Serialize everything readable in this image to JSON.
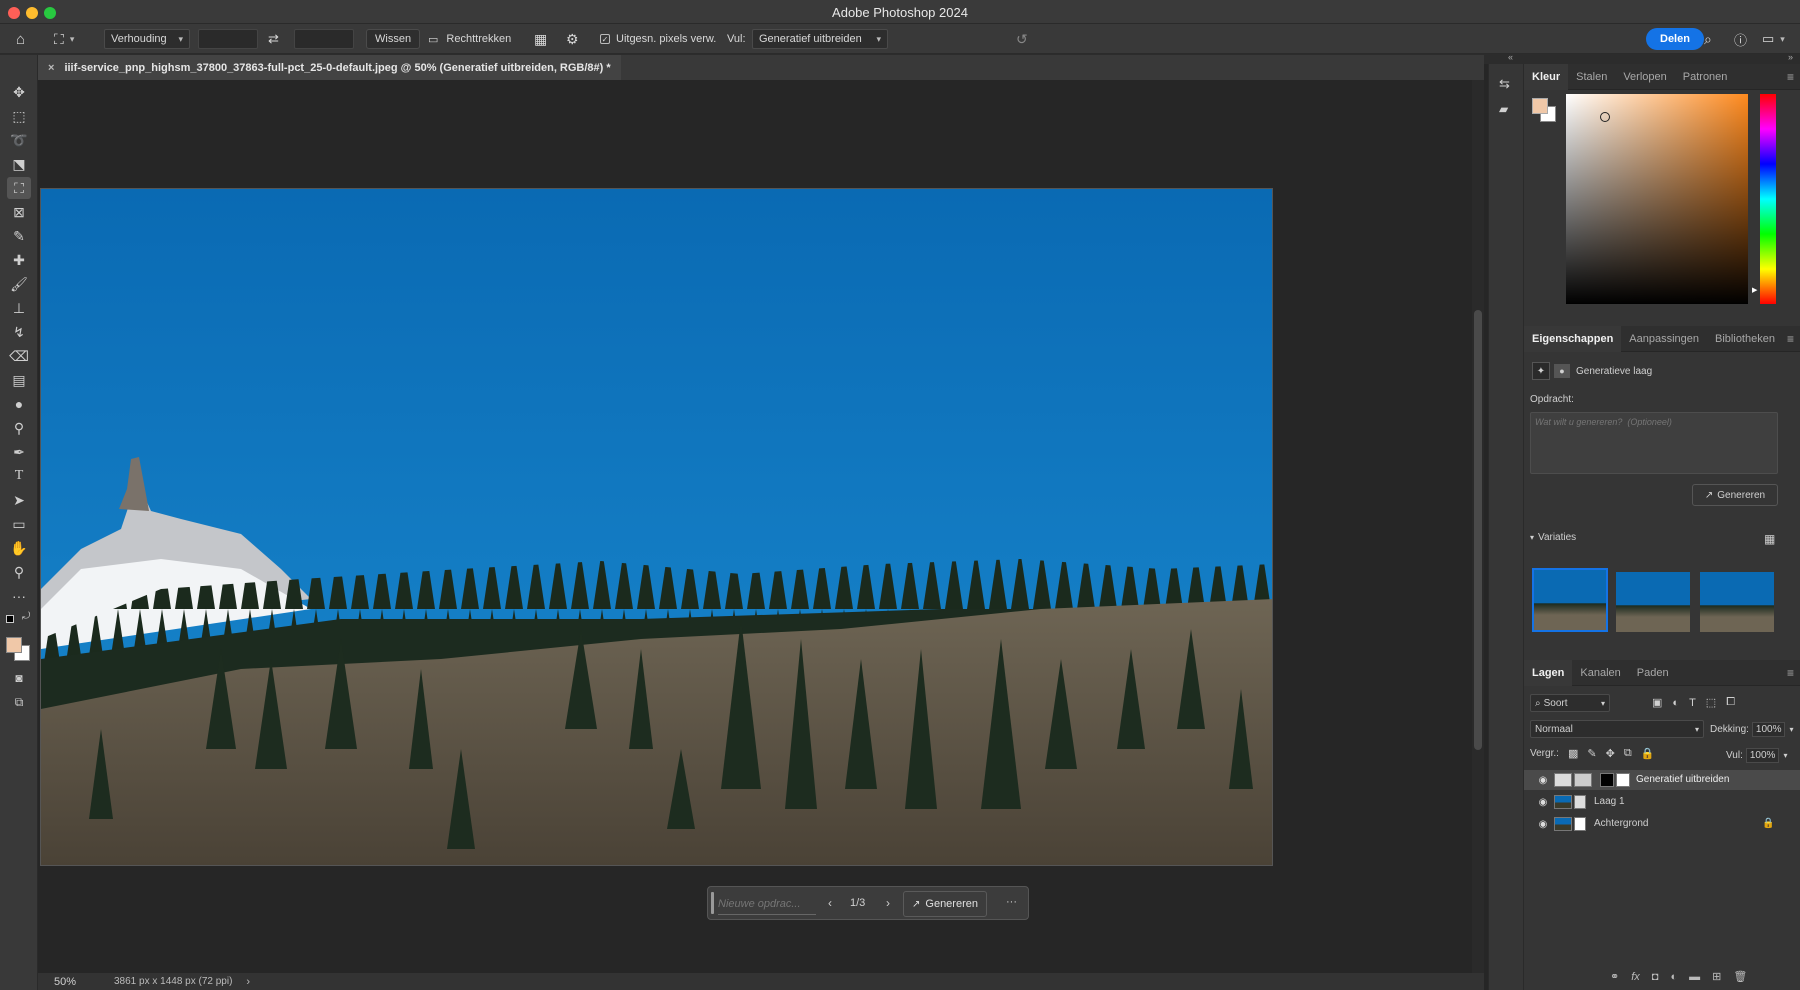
{
  "app_title": "Adobe Photoshop 2024",
  "options_bar": {
    "ratio_select": "Verhouding",
    "clear_label": "Wissen",
    "straighten_label": "Rechttrekken",
    "delete_pixels_label": "Uitgesn. pixels verw.",
    "fill_label": "Vul:",
    "fill_select": "Generatief uitbreiden",
    "share_label": "Delen"
  },
  "document_tab": {
    "title": "iiif-service_pnp_highsm_37800_37863-full-pct_25-0-default.jpeg @ 50% (Generatief uitbreiden, RGB/8#) *",
    "close": "×"
  },
  "status_bar": {
    "zoom": "50%",
    "dimensions": "3861 px x 1448 px (72 ppi)",
    "arrow": "›"
  },
  "gen_bar": {
    "placeholder": "Nieuwe opdrac...",
    "page": "1/3",
    "generate_label": "Genereren",
    "more": "···"
  },
  "color_panel": {
    "tabs": [
      "Kleur",
      "Stalen",
      "Verlopen",
      "Patronen"
    ],
    "foreground_color": "#f0c8a8",
    "hue_color": "#ff8a1e"
  },
  "properties_panel": {
    "tabs": [
      "Eigenschappen",
      "Aanpassingen",
      "Bibliotheken"
    ],
    "layer_type": "Generatieve laag",
    "prompt_label": "Opdracht:",
    "prompt_placeholder": "Wat wilt u genereren?  (Optioneel)",
    "generate_label": "Genereren",
    "variations_label": "Variaties"
  },
  "layers_panel": {
    "tabs": [
      "Lagen",
      "Kanalen",
      "Paden"
    ],
    "filter_label": "Soort",
    "blend_mode": "Normaal",
    "opacity_label": "Dekking:",
    "opacity_value": "100%",
    "lock_label": "Vergr.:",
    "fill_label": "Vul:",
    "fill_value": "100%",
    "layers": [
      {
        "name": "Generatief uitbreiden",
        "selected": true
      },
      {
        "name": "Laag 1",
        "selected": false
      },
      {
        "name": "Achtergrond",
        "selected": false
      }
    ]
  },
  "toolbar_icons": [
    "move-tool",
    "marquee-tool",
    "lasso-tool",
    "object-select-tool",
    "crop-tool",
    "frame-tool",
    "eyedropper-tool",
    "healing-tool",
    "brush-tool",
    "stamp-tool",
    "history-brush-tool",
    "eraser-tool",
    "gradient-tool",
    "blur-tool",
    "dodge-tool",
    "pen-tool",
    "type-tool",
    "path-select-tool",
    "rectangle-tool",
    "hand-tool",
    "zoom-tool",
    "more-tools"
  ],
  "accent_color": "#1473e6"
}
